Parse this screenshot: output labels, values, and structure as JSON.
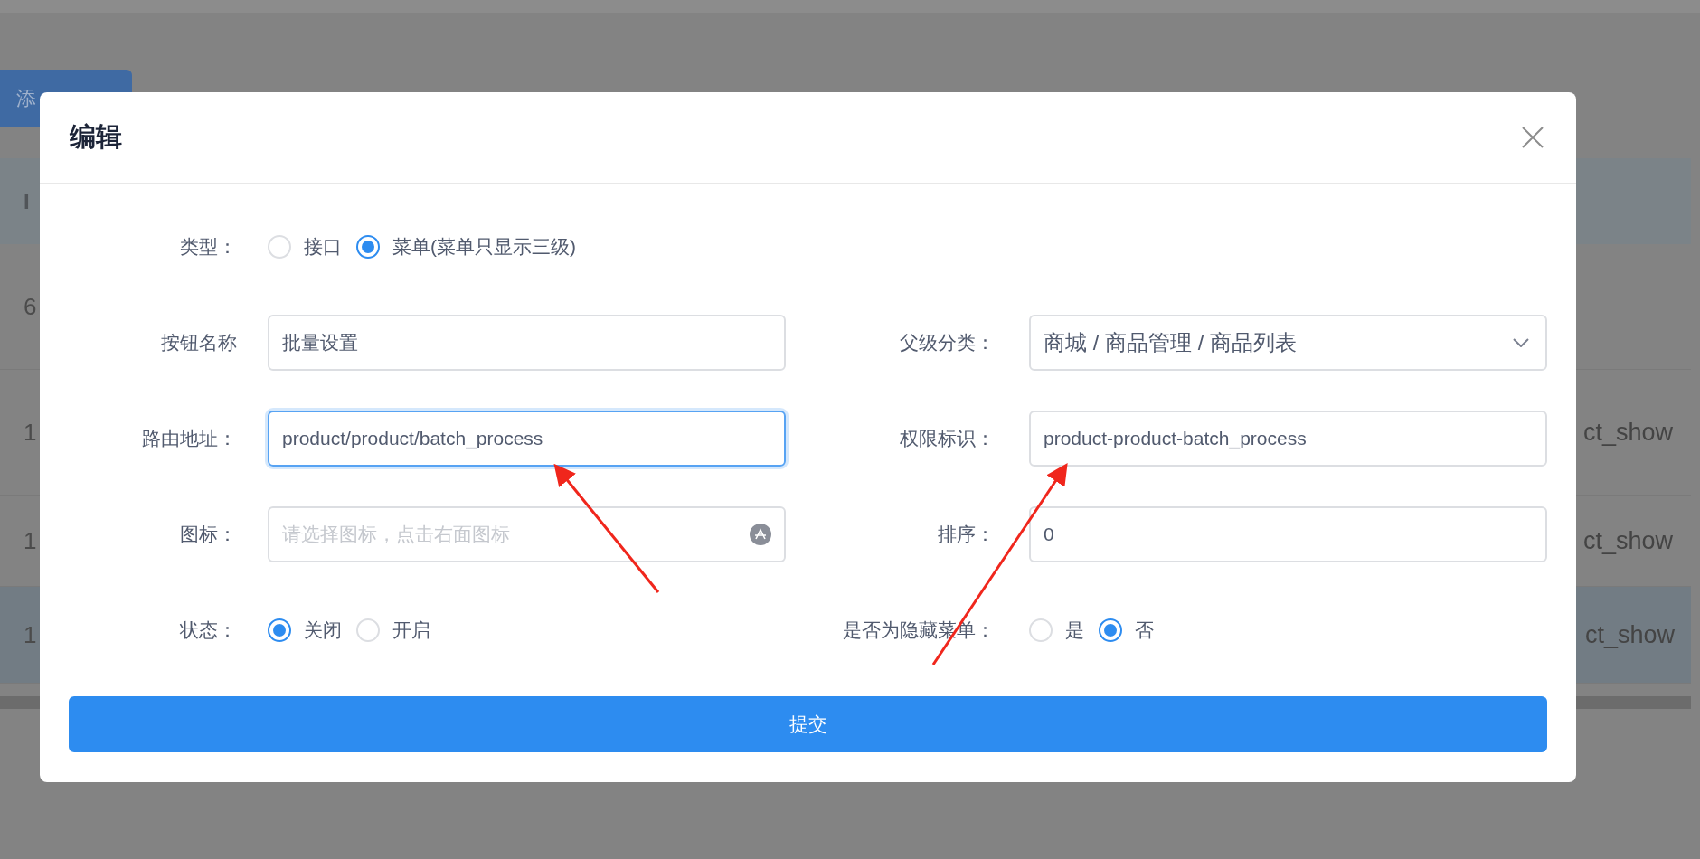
{
  "background": {
    "add_button": "添",
    "table": {
      "header": "I",
      "rows": [
        {
          "id": "6",
          "selected": false
        },
        {
          "id": "1",
          "column_2": "ct_show",
          "selected": false
        },
        {
          "id": "1",
          "column_2": "ct_show",
          "selected": false
        },
        {
          "id": "1",
          "column_2": "ct_show",
          "selected": true
        }
      ]
    }
  },
  "dialog": {
    "title": "编辑",
    "rows": [
      [
        {
          "kind": "radio",
          "label": "类型：",
          "options": [
            {
              "label": "接口",
              "selected": false
            },
            {
              "label": "菜单(菜单只显示三级)",
              "selected": true
            }
          ]
        }
      ],
      [
        {
          "kind": "input",
          "label": "按钮名称",
          "value": "批量设置",
          "focused": false
        },
        {
          "kind": "select",
          "label": "父级分类：",
          "value": "商城 / 商品管理 / 商品列表"
        }
      ],
      [
        {
          "kind": "input",
          "label": "路由地址：",
          "value": "product/product/batch_process",
          "focused": true
        },
        {
          "kind": "input",
          "label": "权限标识：",
          "value": "product-product-batch_process",
          "focused": false
        }
      ],
      [
        {
          "kind": "icon_input",
          "label": "图标：",
          "placeholder": "请选择图标，点击右面图标"
        },
        {
          "kind": "input",
          "label": "排序：",
          "value": "0",
          "focused": false
        }
      ],
      [
        {
          "kind": "radio",
          "label": "状态：",
          "options": [
            {
              "label": "关闭",
              "selected": true
            },
            {
              "label": "开启",
              "selected": false
            }
          ]
        },
        {
          "kind": "radio",
          "label": "是否为隐藏菜单：",
          "options": [
            {
              "label": "是",
              "selected": false
            },
            {
              "label": "否",
              "selected": true
            }
          ]
        }
      ]
    ],
    "submit": "提交"
  }
}
